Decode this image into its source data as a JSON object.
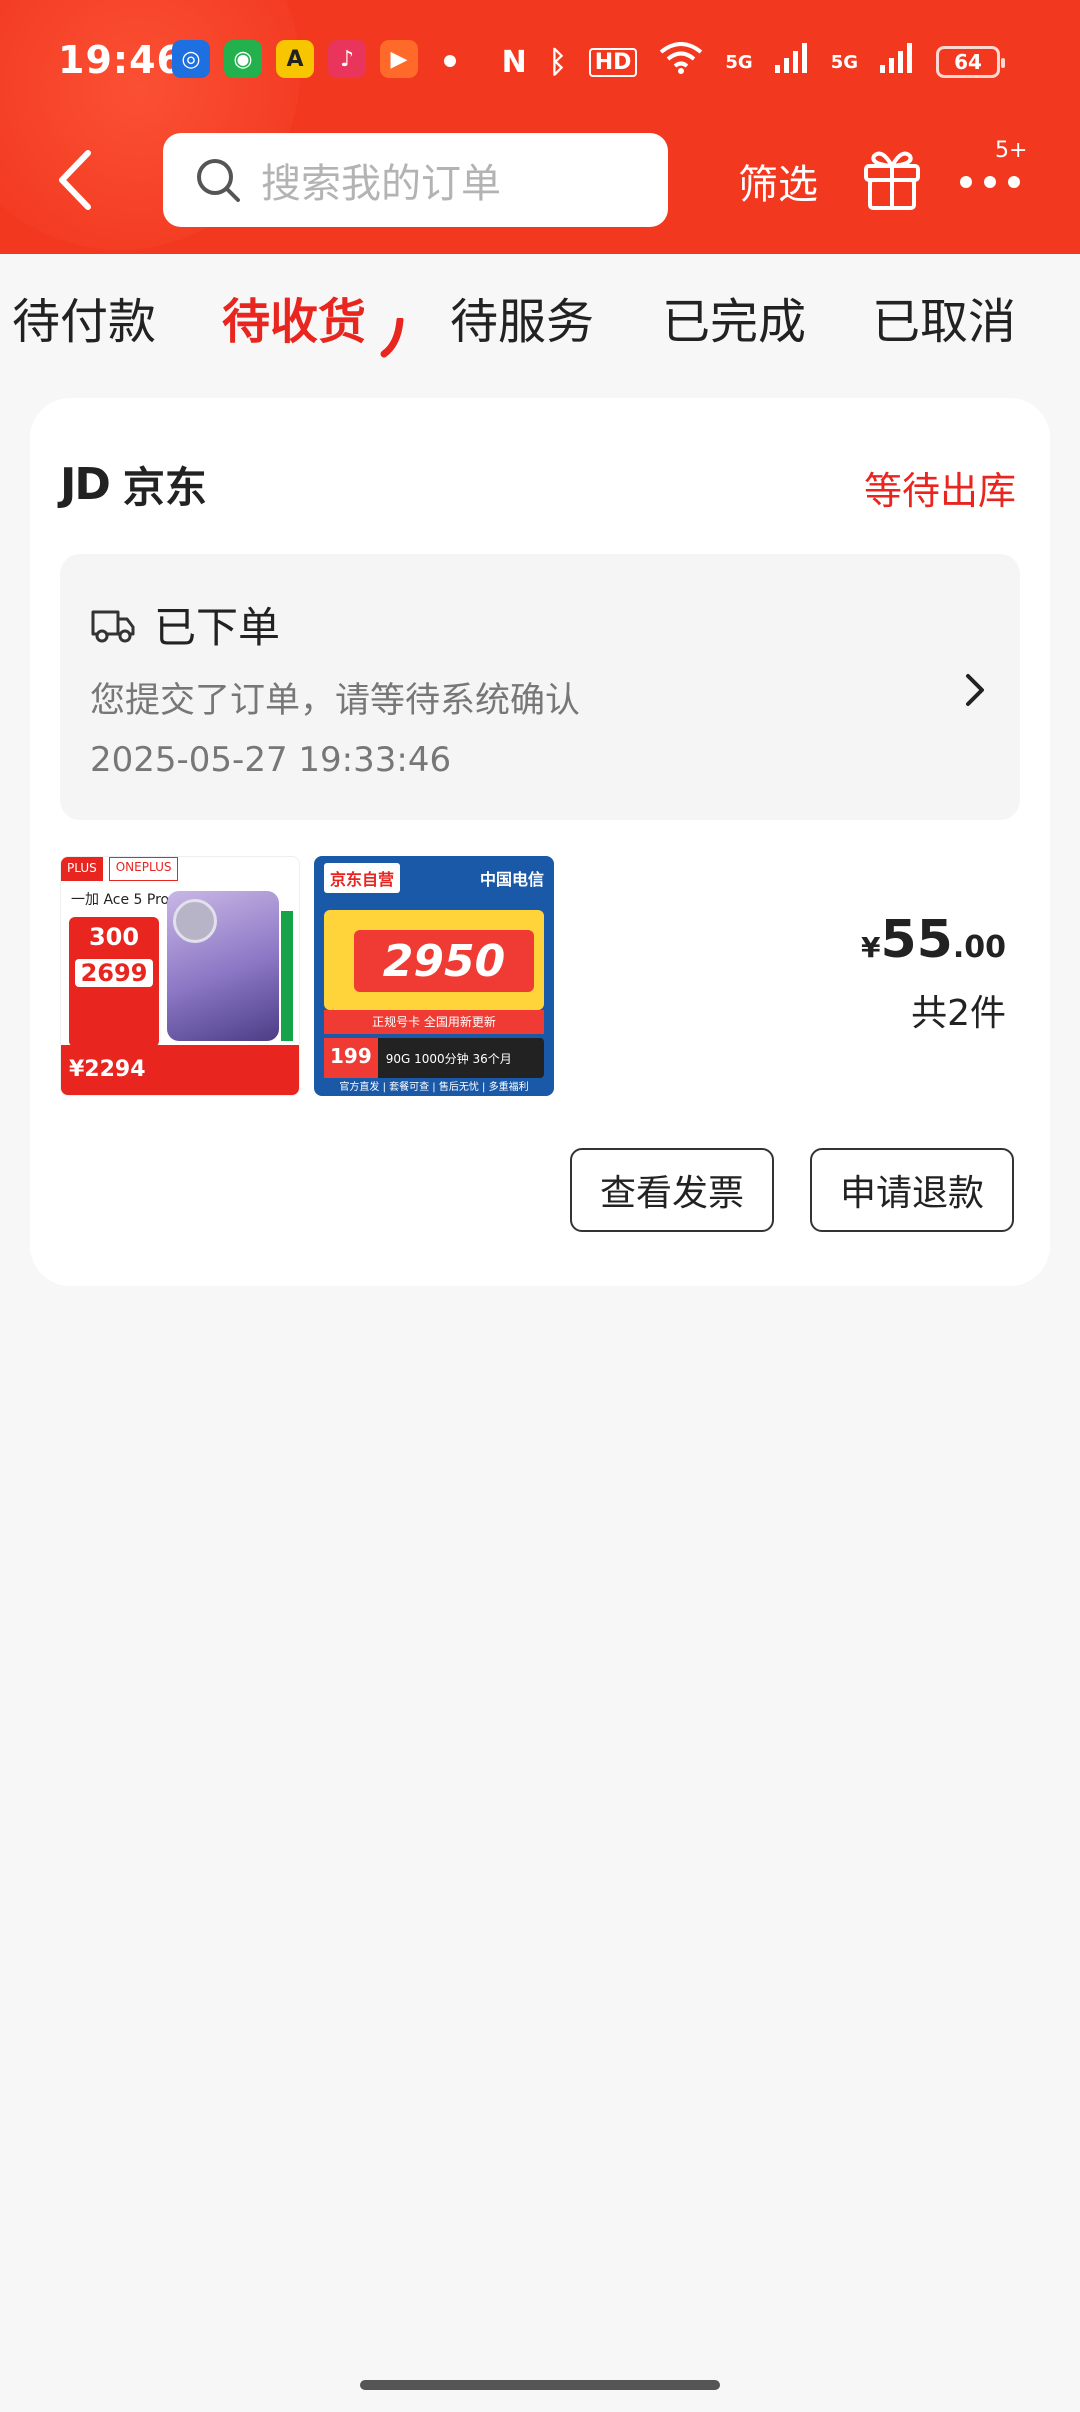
{
  "status_bar": {
    "time": "19:46",
    "battery": "64",
    "net_5g_a": "5G",
    "net_5g_b": "5G",
    "hd": "HD"
  },
  "header": {
    "search_placeholder": "搜索我的订单",
    "filter_label": "筛选",
    "more_badge": "5+"
  },
  "tabs": [
    {
      "label": "待付款",
      "active": false
    },
    {
      "label": "待收货",
      "active": true
    },
    {
      "label": "待服务",
      "active": false
    },
    {
      "label": "已完成",
      "active": false
    },
    {
      "label": "已取消",
      "active": false
    }
  ],
  "order": {
    "shop_logo": "JD",
    "shop_name": "京东",
    "status": "等待出库",
    "tracking": {
      "title": "已下单",
      "description": "您提交了订单，请等待系统确认",
      "time": "2025-05-27 19:33:46"
    },
    "thumb1": {
      "badge": "PLUS",
      "brand": "ONEPLUS",
      "model": "一加 Ace 5 Pro",
      "price_a": "300",
      "price_b": "2699",
      "price_c": "¥2294"
    },
    "thumb2": {
      "jd_label": "京东自营",
      "telecom_label": "中国电信",
      "big_number": "2950",
      "strip_text": "正规号卡 全国用新更新",
      "price": "199",
      "minutes": "90G 1000分钟 36个月",
      "footer": "官方直发 | 套餐可查 | 售后无忧 | 多重福利"
    },
    "price": {
      "symbol": "¥",
      "integer": "55",
      "decimal": ".00"
    },
    "quantity": "共2件",
    "buttons": {
      "invoice": "查看发票",
      "refund": "申请退款"
    }
  },
  "colors": {
    "brand_red": "#f2381f",
    "active_tab": "#e8251f",
    "background": "#f7f7f7"
  }
}
